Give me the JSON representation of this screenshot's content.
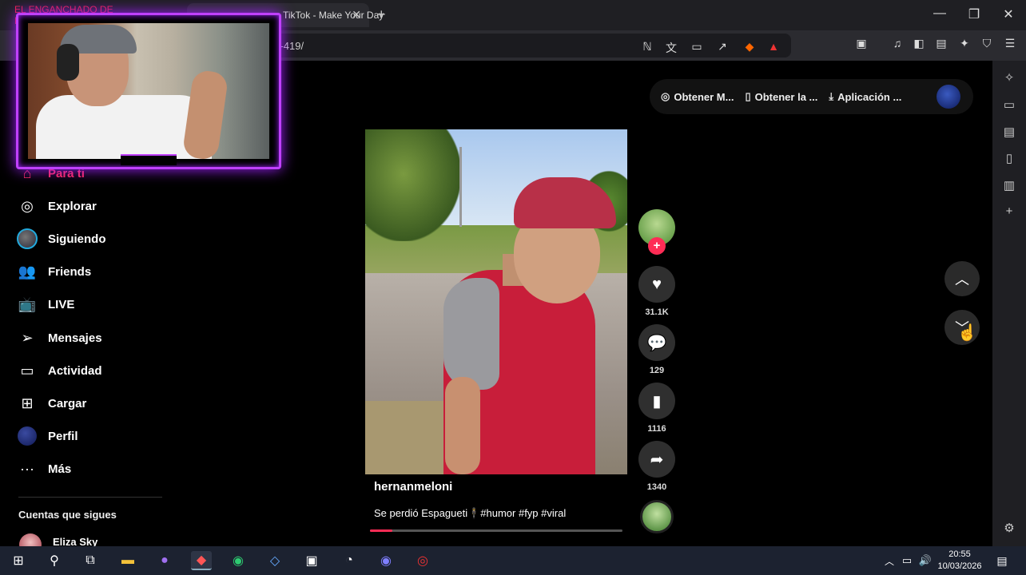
{
  "browser": {
    "tabs": [
      {
        "label": "EL ENGANCHADO DE REGGAETON"
      },
      {
        "label": "TikTok - Make Your Day"
      }
    ],
    "url": "/...-419/",
    "accent_color": "#fe2c55"
  },
  "nav": {
    "items": [
      {
        "label": "Para ti",
        "icon": "home-icon"
      },
      {
        "label": "Explorar",
        "icon": "compass-icon"
      },
      {
        "label": "Siguiendo",
        "icon": "following-avatar-icon"
      },
      {
        "label": "Friends",
        "icon": "friends-icon"
      },
      {
        "label": "LIVE",
        "icon": "live-icon"
      },
      {
        "label": "Mensajes",
        "icon": "message-icon"
      },
      {
        "label": "Actividad",
        "icon": "activity-icon"
      },
      {
        "label": "Cargar",
        "icon": "upload-icon"
      },
      {
        "label": "Perfil",
        "icon": "profile-avatar-icon"
      },
      {
        "label": "Más",
        "icon": "more-icon"
      }
    ],
    "following_title": "Cuentas que sigues",
    "following": [
      {
        "name": "Eliza Sky"
      }
    ]
  },
  "getapp": {
    "items": [
      {
        "label": "Obtener M...",
        "icon": "coin-icon"
      },
      {
        "label": "Obtener la ...",
        "icon": "phone-icon"
      },
      {
        "label": "Aplicación ...",
        "icon": "download-icon"
      }
    ]
  },
  "video": {
    "username": "hernanmeloni",
    "caption": "Se perdió Espagueti🕴#humor #fyp #viral",
    "progress": 0.09
  },
  "actions": {
    "likes": "31.1K",
    "comments": "129",
    "saves": "1116",
    "shares": "1340"
  },
  "taskbar": {
    "time": "20:55",
    "date": "10/03/2026"
  }
}
